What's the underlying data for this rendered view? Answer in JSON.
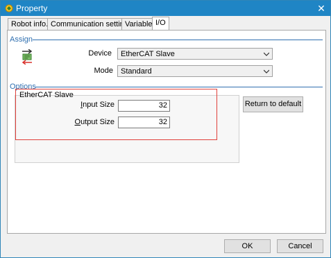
{
  "window": {
    "title": "Property",
    "close_glyph": "✕"
  },
  "tabs": [
    {
      "label": "Robot info.",
      "active": false
    },
    {
      "label": "Communication setting",
      "active": false
    },
    {
      "label": "Variable",
      "active": false
    },
    {
      "label": "I/O",
      "active": true
    }
  ],
  "assign": {
    "group_label": "Assign",
    "device_label": "Device",
    "device_value": "EtherCAT Slave",
    "mode_label": "Mode",
    "mode_value": "Standard"
  },
  "options": {
    "group_label": "Options",
    "subgroup_label": "EtherCAT Slave",
    "input_size_label_pre": "I",
    "input_size_label_post": "nput Size",
    "input_size_value": "32",
    "output_size_label_pre": "O",
    "output_size_label_post": "utput Size",
    "output_size_value": "32",
    "return_button": "Return to default"
  },
  "footer": {
    "ok": "OK",
    "cancel": "Cancel"
  },
  "colors": {
    "titlebar": "#1f85c5",
    "group_text": "#2f6fb0",
    "highlight": "#e0403a"
  }
}
